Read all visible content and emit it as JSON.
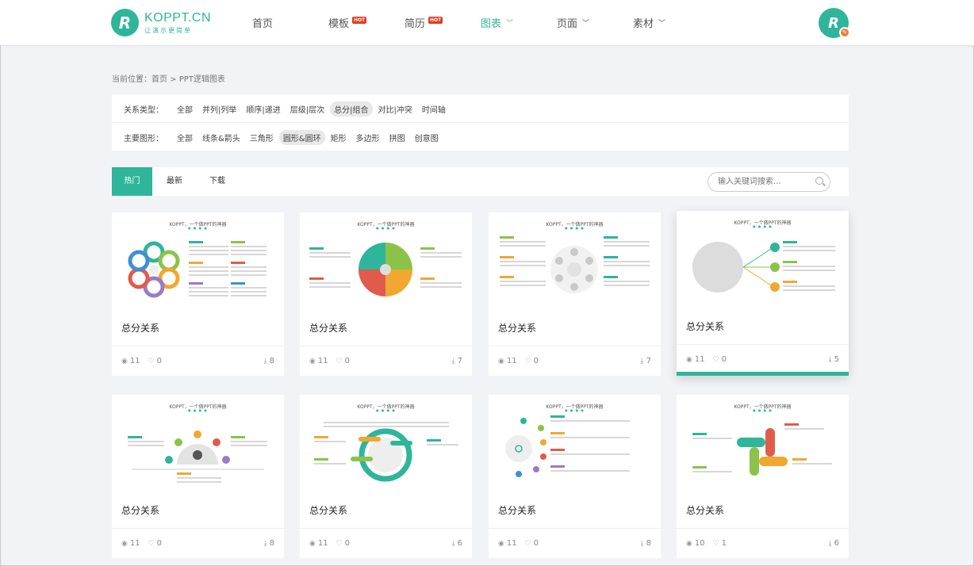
{
  "header": {
    "logo_letter": "R",
    "logo_main": "KOPPT.CN",
    "logo_sub": "让演示更简单",
    "nav": [
      {
        "label": "首页",
        "hot": false,
        "dropdown": false,
        "active": false
      },
      {
        "label": "模板",
        "hot": true,
        "dropdown": false,
        "active": false
      },
      {
        "label": "简历",
        "hot": true,
        "dropdown": false,
        "active": false
      },
      {
        "label": "图表",
        "hot": false,
        "dropdown": true,
        "active": true
      },
      {
        "label": "页面",
        "hot": false,
        "dropdown": true,
        "active": false
      },
      {
        "label": "素材",
        "hot": false,
        "dropdown": true,
        "active": false
      }
    ],
    "hot_badge": "HOT",
    "avatar_letter": "R"
  },
  "breadcrumb": "当前位置：首页 > PPT逻辑图表",
  "filters": {
    "relation_label": "关系类型：",
    "relation_options": [
      "全部",
      "并列|列举",
      "顺序|递进",
      "层级|层次",
      "总分|组合",
      "对比|冲突",
      "时间轴"
    ],
    "relation_selected": "总分|组合",
    "shape_label": "主要图形：",
    "shape_options": [
      "全部",
      "线条&箭头",
      "三角形",
      "圆形&圆环",
      "矩形",
      "多边形",
      "拼图",
      "创意图"
    ],
    "shape_selected": "圆形&圆环"
  },
  "tabs": [
    "热门",
    "最新",
    "下载"
  ],
  "active_tab": "热门",
  "search": {
    "placeholder": "输入关键词搜索..."
  },
  "thumb_title": "KOPPT，一个做PPT的神器",
  "thumb_stars": "● ● ● ●",
  "cards": [
    {
      "title": "总分关系",
      "views": "11",
      "likes": "0",
      "downloads": "8"
    },
    {
      "title": "总分关系",
      "views": "11",
      "likes": "0",
      "downloads": "7"
    },
    {
      "title": "总分关系",
      "views": "11",
      "likes": "0",
      "downloads": "7"
    },
    {
      "title": "总分关系",
      "views": "11",
      "likes": "0",
      "downloads": "5"
    },
    {
      "title": "总分关系",
      "views": "11",
      "likes": "0",
      "downloads": "8"
    },
    {
      "title": "总分关系",
      "views": "11",
      "likes": "0",
      "downloads": "6"
    },
    {
      "title": "总分关系",
      "views": "11",
      "likes": "0",
      "downloads": "8"
    },
    {
      "title": "总分关系",
      "views": "10",
      "likes": "1",
      "downloads": "6"
    }
  ],
  "colors": {
    "accent": "#2fb599",
    "hot": "#e23b1e",
    "page_bg": "#f2f3f7"
  }
}
